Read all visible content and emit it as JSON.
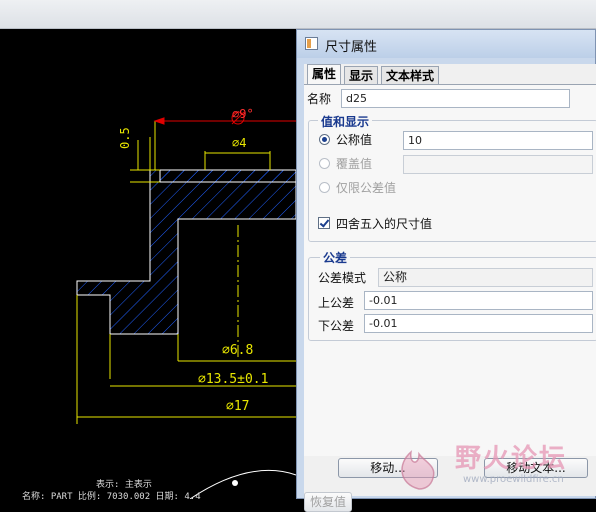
{
  "window": {
    "title": "尺寸属性"
  },
  "tabs": [
    {
      "label": "属性",
      "active": true
    },
    {
      "label": "显示",
      "active": false
    },
    {
      "label": "文本样式",
      "active": false
    }
  ],
  "name": {
    "label": "名称",
    "value": "d25"
  },
  "value_display": {
    "title": "值和显示",
    "nominal": {
      "label": "公称值",
      "value": "10",
      "selected": true
    },
    "override": {
      "label": "覆盖值",
      "value": "",
      "enabled": false
    },
    "tolerance_only": {
      "label": "仅限公差值",
      "enabled": false
    },
    "rounded": {
      "label": "四舍五入的尺寸值",
      "checked": true
    }
  },
  "tolerance": {
    "title": "公差",
    "mode": {
      "label": "公差模式",
      "value": "公称"
    },
    "upper": {
      "label": "上公差",
      "value": "-0.01"
    },
    "lower": {
      "label": "下公差",
      "value": "-0.01"
    }
  },
  "buttons": {
    "move": "移动...",
    "move_text": "移动文本...",
    "restore": "恢复值"
  },
  "drawing": {
    "dims": {
      "d9": "∅9°",
      "d4": "∅4",
      "d05": "0.5",
      "d68": "∅6.8",
      "d135": "∅13.5±0.1",
      "d17": "∅17"
    },
    "notes": {
      "line1": "表示: 主表示",
      "line2": "名称: PART   比例: 7030.002   日期: 4.4"
    }
  },
  "watermark": {
    "text": "野火论坛",
    "url": "www.proewildfire.cn"
  },
  "colors": {
    "dim_yellow": "#e8e600",
    "dim_green": "#00d400",
    "dim_red": "#e00000",
    "hatch": "#2060ff"
  }
}
